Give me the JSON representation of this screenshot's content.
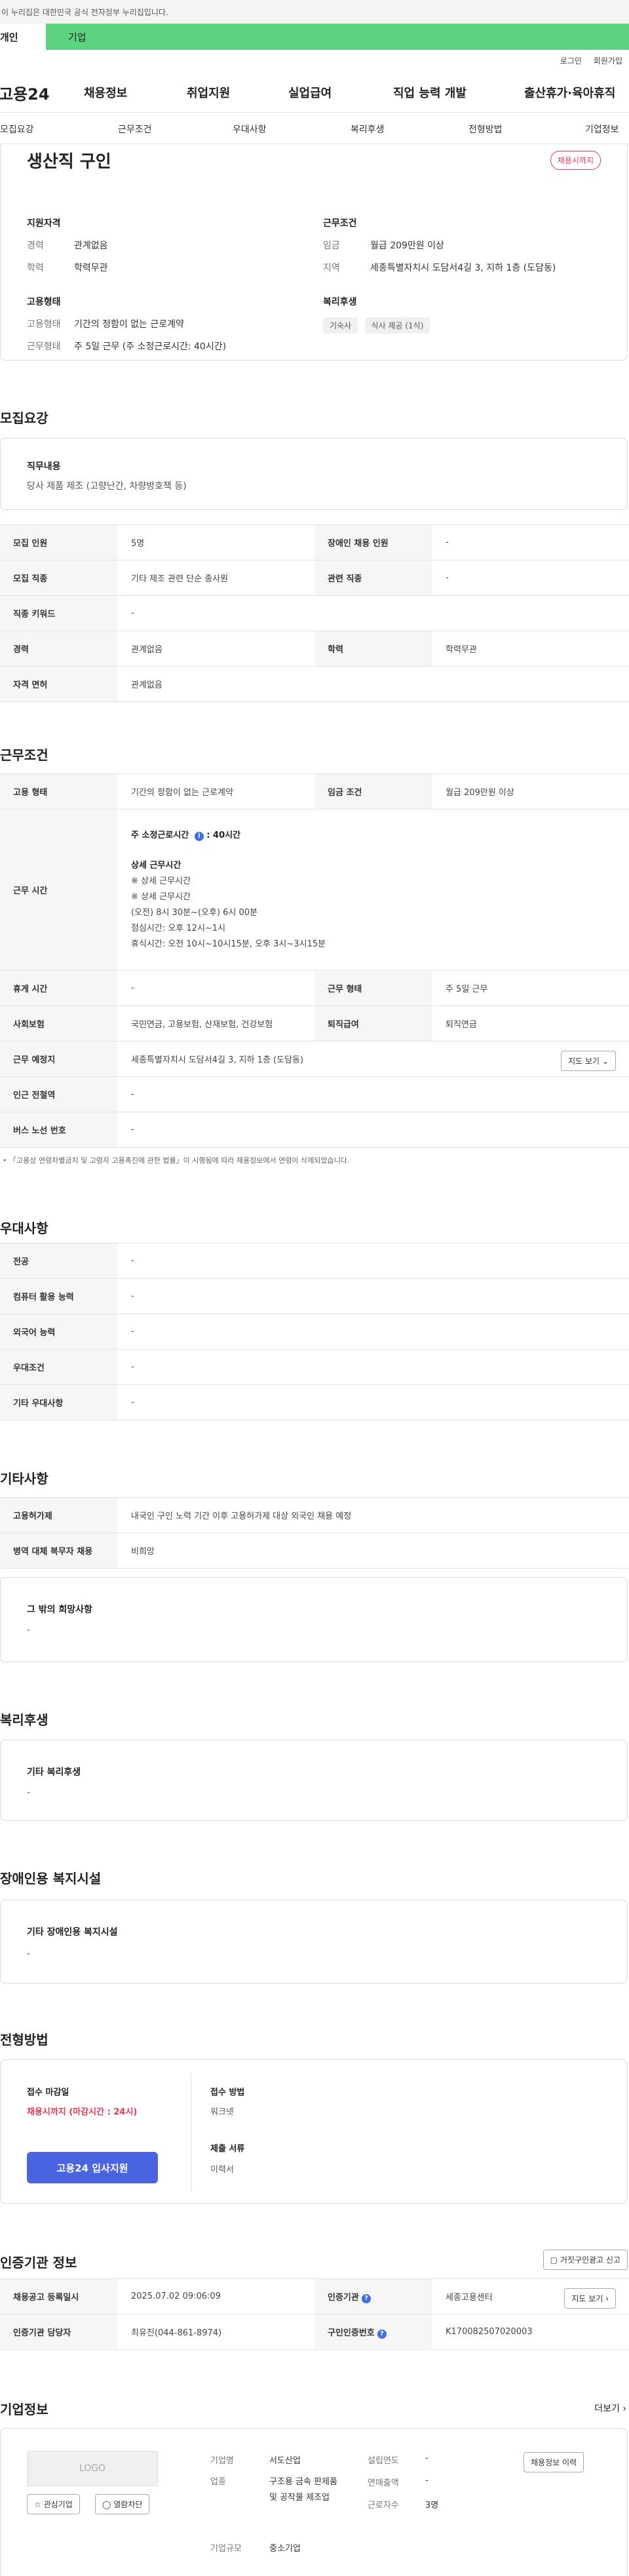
{
  "notice": "이 누리집은 대한민국 공식 전자정부 누리집입니다.",
  "tabs": {
    "personal": "개인",
    "company": "기업"
  },
  "utility": {
    "login": "로그인",
    "join": "회원가입"
  },
  "gnb": {
    "logo": "고용24",
    "menu": [
      "채용정보",
      "취업지원",
      "실업급여",
      "직업 능력 개발",
      "출산휴가·육아휴직"
    ]
  },
  "subnav": [
    "모집요강",
    "근무조건",
    "우대사항",
    "복리후생",
    "전형방법",
    "기업정보"
  ],
  "summary": {
    "title": "생산직 구인",
    "badge": "채용시까지",
    "qual_title": "지원자격",
    "career_k": "경력",
    "career_v": "관계없음",
    "edu_k": "학력",
    "edu_v": "학력무관",
    "emp_title": "고용형태",
    "emp_k": "고용형태",
    "emp_v": "기간의 정함이 없는 근로계약",
    "work_k": "근무형태",
    "work_v": "주 5일 근무 (주 소정근로시간: 40시간)",
    "cond_title": "근무조건",
    "wage_k": "임금",
    "wage_v": "월급 209만원 이상",
    "loc_k": "지역",
    "loc_v": "세종특별자치시 도담서4길 3, 지하 1층 (도담동)",
    "welfare_title": "복리후생",
    "chips": [
      "기숙사",
      "식사 제공 (1식)"
    ]
  },
  "recruit": {
    "title": "모집요강",
    "duty_title": "직무내용",
    "duty_desc": "당사 제품 제조 (고량난간, 차량방호책 등)",
    "rows": [
      [
        "모집 인원",
        "5명",
        "장애인 채용 인원",
        "-"
      ],
      [
        "모집 직종",
        "기타 제조 관련 단순 종사원",
        "관련 직종",
        "-"
      ],
      [
        "직종 키워드",
        "-"
      ],
      [
        "경력",
        "관계없음",
        "학력",
        "학력무관"
      ],
      [
        "자격 면허",
        "관계없음"
      ]
    ]
  },
  "conditions": {
    "title": "근무조건",
    "emp_k": "고용 형태",
    "emp_v": "기간의 정함이 없는 근로계약",
    "wage_k": "임금 조건",
    "wage_v": "월급 209만원 이상",
    "time_k": "근무 시간",
    "time_lines": [
      "주 소정근로시간",
      "40시간",
      "상세 근무시간",
      "※ 상세 근무시간",
      "※ 상세 근무시간",
      "(오전) 8시 30분~(오후) 6시 00분",
      "점심시간: 오후 12시~1시",
      "휴식시간: 오전 10시~10시15분, 오후 3시~3시15분"
    ],
    "rest_k": "휴게 시간",
    "rest_v": "-",
    "form_k": "근무 형태",
    "form_v": "주 5일 근무",
    "ins_k": "사회보험",
    "ins_v": "국민연금, 고용보험, 산재보험, 건강보험",
    "ret_k": "퇴직급여",
    "ret_v": "퇴직연금",
    "place_k": "근무 예정지",
    "place_v": "세종특별자치시 도담서4길 3, 지하 1층 (도담동)",
    "map_btn": "지도 보기",
    "sub_k": "인근 전철역",
    "sub_v": "-",
    "bus_k": "버스 노선 번호",
    "bus_v": "-",
    "footnote": "「고용상 연령차별금지 및 고령자 고용촉진에 관한 법률」이 시행됨에 따라 채용정보에서 연령이 삭제되었습니다."
  },
  "prefer": {
    "title": "우대사항",
    "rows": [
      [
        "전공",
        "-"
      ],
      [
        "컴퓨터 활용 능력",
        "-"
      ],
      [
        "외국어 능력",
        "-"
      ],
      [
        "우대조건",
        "-"
      ],
      [
        "기타 우대사항",
        "-"
      ]
    ]
  },
  "etc": {
    "title": "기타사항",
    "rows": [
      [
        "고용허가제",
        "내국인 구인 노력 기간 이후 고용허가제 대상 외국인 채용 예정"
      ],
      [
        "병역 대체 복무자 채용",
        "비희망"
      ]
    ],
    "wish_title": "그 밖의 희망사항",
    "wish_v": "-"
  },
  "welfare": {
    "title": "복리후생",
    "card_title": "기타 복리후생",
    "card_v": "-"
  },
  "disability": {
    "title": "장애인용 복지시설",
    "card_title": "기타 장애인용 복지시설",
    "card_v": "-"
  },
  "process": {
    "title": "전형방법",
    "deadline_k": "접수 마감일",
    "deadline_v": "채용시까지 (마감시간 : 24시)",
    "apply_btn": "고용24 입사지원",
    "method_k": "접수 방법",
    "method_v": "워크넷",
    "docs_k": "제출 서류",
    "docs_v": "이력서"
  },
  "agency": {
    "title": "인증기관 정보",
    "report_btn": "거짓구인광고 신고",
    "rows": {
      "reg_k": "채용공고 등록일시",
      "reg_v": "2025.07.02 09:06:09",
      "org_k": "인증기관",
      "org_v": "세종고용센터",
      "mgr_k": "인증기관 담당자",
      "mgr_v": "최유진(044-861-8974)",
      "num_k": "구인인증번호",
      "num_v": "K170082507020003",
      "map_btn": "지도 보기"
    }
  },
  "company": {
    "title": "기업정보",
    "more": "더보기",
    "logo": "LOGO",
    "fav_btn": "관심기업",
    "block_btn": "열람차단",
    "name_k": "기업명",
    "name_v": "서도산업",
    "ind_k": "업종",
    "ind_v": "구조용 금속 판제품 및 공작물 제조업",
    "size_k": "기업규모",
    "size_v": "중소기업",
    "est_k": "설립연도",
    "est_v": "-",
    "sales_k": "연매출액",
    "sales_v": "-",
    "emp_k": "근로자수",
    "emp_v": "3명",
    "history_btn": "채용정보 이력"
  }
}
